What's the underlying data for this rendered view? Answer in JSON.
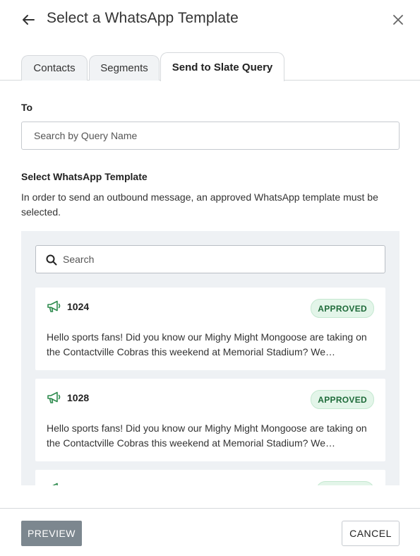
{
  "header": {
    "title": "Select a WhatsApp Template",
    "back_icon": "arrow-left-icon",
    "close_icon": "close-icon"
  },
  "tabs": [
    {
      "label": "Contacts",
      "active": false
    },
    {
      "label": "Segments",
      "active": false
    },
    {
      "label": "Send to Slate Query",
      "active": true
    }
  ],
  "form": {
    "to_label": "To",
    "to_placeholder": "Search by Query Name",
    "template_label": "Select WhatsApp Template",
    "template_description": "In order to send an outbound message, an approved WhatsApp template must be selected."
  },
  "template_panel": {
    "search_placeholder": "Search",
    "templates": [
      {
        "name": "1024",
        "status": "APPROVED",
        "body": "Hello sports fans! Did you know our Mighy Might Mongoose are taking on the Contactville Cobras this weekend at Memorial Stadium? We…",
        "icon": "megaphone-icon"
      },
      {
        "name": "1028",
        "status": "APPROVED",
        "body": "Hello sports fans! Did you know our Mighy Might Mongoose are taking on the Contactville Cobras this weekend at Memorial Stadium? We…",
        "icon": "megaphone-icon"
      }
    ]
  },
  "footer": {
    "preview_label": "PREVIEW",
    "cancel_label": "CANCEL"
  },
  "colors": {
    "approved_bg": "#e3f5e9",
    "approved_text": "#1f6b3a",
    "icon_green": "#2e8b4e",
    "panel_bg": "#eef1f4",
    "preview_disabled": "#7c878f"
  }
}
